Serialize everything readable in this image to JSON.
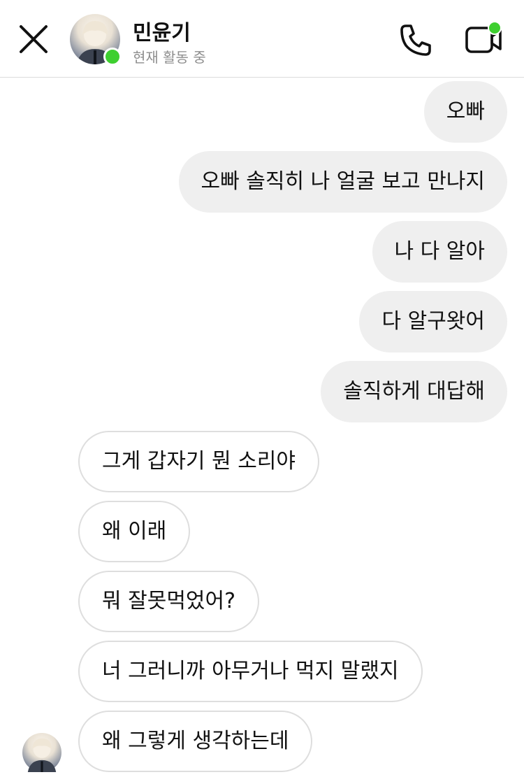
{
  "header": {
    "contact_name": "민윤기",
    "status": "현재 활동 중",
    "online_color": "#3ecf2f",
    "icons": [
      "close-icon",
      "phone-icon",
      "video-call-icon"
    ]
  },
  "messages": [
    {
      "from": "me",
      "text": "오빠"
    },
    {
      "from": "me",
      "text": "오빠 솔직히 나 얼굴 보고 만나지"
    },
    {
      "from": "me",
      "text": "나 다 알아"
    },
    {
      "from": "me",
      "text": "다 알구왓어"
    },
    {
      "from": "me",
      "text": "솔직하게 대답해"
    },
    {
      "from": "them",
      "text": "그게 갑자기 뭔 소리야"
    },
    {
      "from": "them",
      "text": "왜 이래"
    },
    {
      "from": "them",
      "text": "뭐 잘못먹었어?"
    },
    {
      "from": "them",
      "text": "너 그러니까 아무거나 먹지 말랬지"
    },
    {
      "from": "them",
      "text": "왜 그렇게 생각하는데"
    }
  ]
}
